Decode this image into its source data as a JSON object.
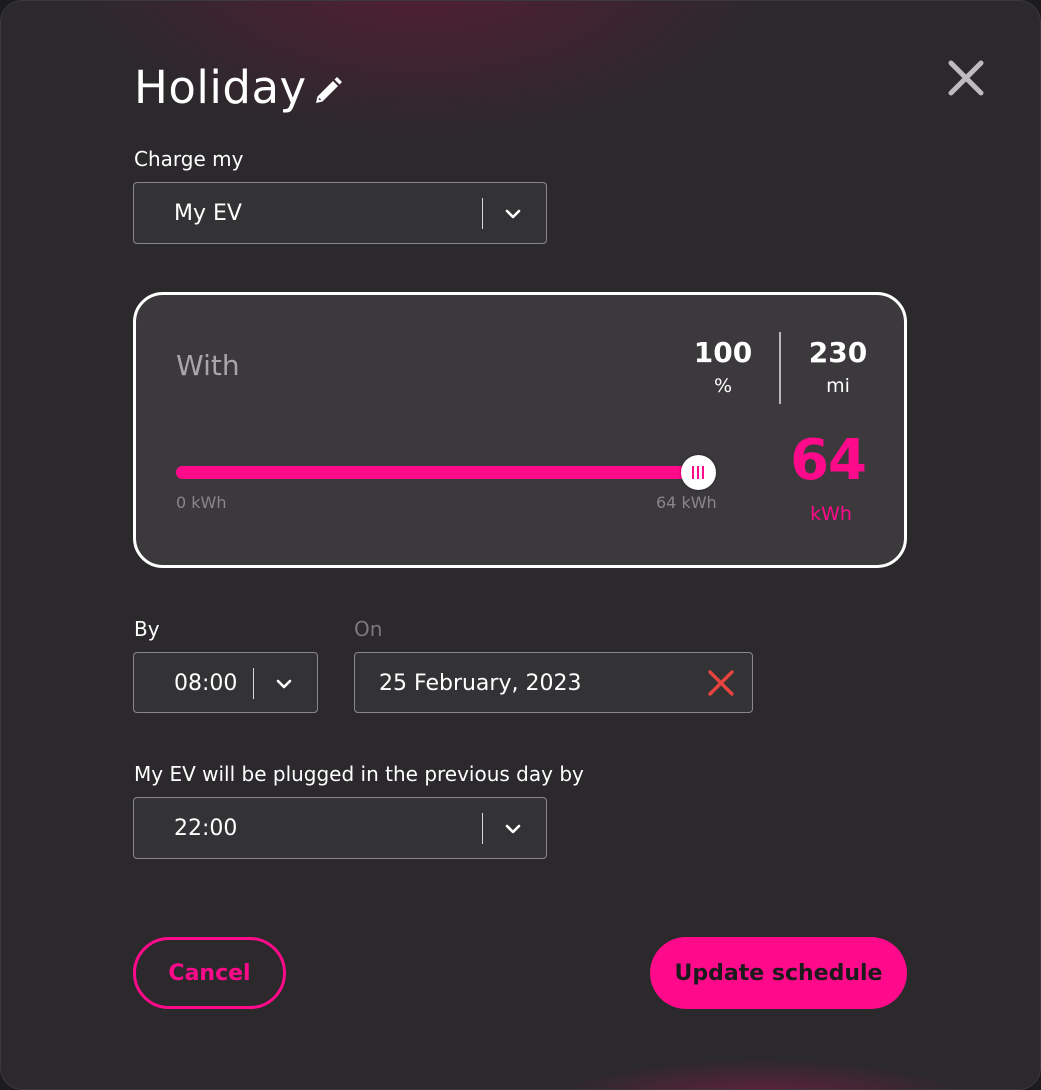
{
  "modal": {
    "title": "Holiday",
    "icons": {
      "edit": "pencil-icon",
      "close": "close-icon"
    }
  },
  "charge_my": {
    "label": "Charge my",
    "selected": "My EV"
  },
  "energy": {
    "with_label": "With",
    "percent_value": "100",
    "percent_unit": "%",
    "range_value": "230",
    "range_unit": "mi",
    "slider_min_label": "0 kWh",
    "slider_max_label": "64 kWh",
    "slider_fraction": 1.0,
    "kwh_value": "64",
    "kwh_unit": "kWh"
  },
  "by": {
    "label": "By",
    "selected": "08:00"
  },
  "on": {
    "label": "On",
    "date": "25 February, 2023",
    "clear_icon": "clear-x-icon"
  },
  "plugged": {
    "label": "My EV will be plugged in the previous day by",
    "selected": "22:00"
  },
  "actions": {
    "cancel": "Cancel",
    "update": "Update schedule"
  },
  "colors": {
    "accent": "#ff0a8a",
    "background": "#2b292c",
    "clear_red": "#e8443f"
  }
}
